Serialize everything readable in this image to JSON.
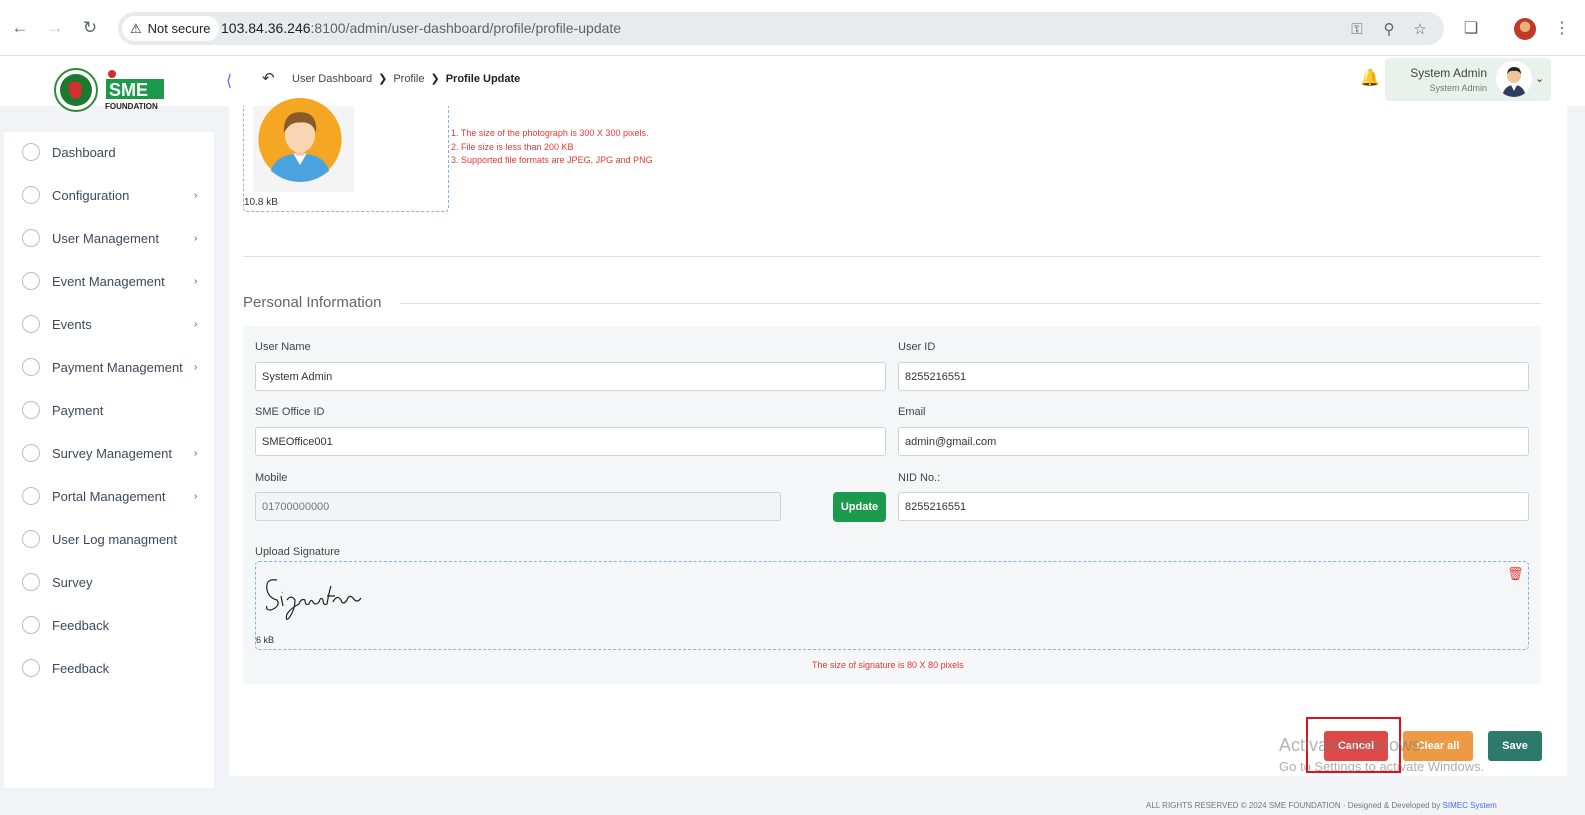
{
  "browser": {
    "security_label": "Not secure",
    "url_host": "103.84.36.246",
    "url_rest": ":8100/admin/user-dashboard/profile/profile-update"
  },
  "header": {
    "logo_text": "SME",
    "logo_subtext": "FOUNDATION",
    "breadcrumb": [
      "User Dashboard",
      "Profile",
      "Profile Update"
    ],
    "user_name": "System Admin",
    "user_role": "System Admin"
  },
  "sidebar": {
    "items": [
      {
        "label": "Dashboard",
        "icon": "dashboard-icon",
        "has_children": false
      },
      {
        "label": "Configuration",
        "icon": "configuration-icon",
        "has_children": true
      },
      {
        "label": "User Management",
        "icon": "user-management-icon",
        "has_children": true
      },
      {
        "label": "Event Management",
        "icon": "lock-icon",
        "has_children": true
      },
      {
        "label": "Events",
        "icon": "lock-icon",
        "has_children": true
      },
      {
        "label": "Payment Management",
        "icon": "payment-icon",
        "has_children": true
      },
      {
        "label": "Payment",
        "icon": "payment-icon",
        "has_children": false
      },
      {
        "label": "Survey Management",
        "icon": "pie-chart-icon",
        "has_children": true
      },
      {
        "label": "Portal Management",
        "icon": "lock-icon",
        "has_children": true
      },
      {
        "label": "User Log managment",
        "icon": "payment-icon",
        "has_children": false
      },
      {
        "label": "Survey",
        "icon": "pie-chart-icon",
        "has_children": false
      },
      {
        "label": "Feedback",
        "icon": "feedback-icon",
        "has_children": false
      },
      {
        "label": "Feedback",
        "icon": "feedback-icon",
        "has_children": false
      }
    ]
  },
  "photo": {
    "size": "10.8 kB",
    "rules": [
      "1. The size of the photograph is 300 X 300 pixels.",
      "2. File size is less than 200 KB",
      "3. Supported file formats are JPEG, JPG and PNG"
    ]
  },
  "personal": {
    "title": "Personal Information",
    "user_name_label": "User Name",
    "user_name_value": "System Admin",
    "user_id_label": "User ID",
    "user_id_value": "8255216551",
    "office_label": "SME Office ID",
    "office_value": "SMEOffice001",
    "email_label": "Email",
    "email_value": "admin@gmail.com",
    "mobile_label": "Mobile",
    "mobile_placeholder": "01700000000",
    "update_label": "Update",
    "nid_label": "NID No.:",
    "nid_value": "8255216551",
    "signature_label": "Upload Signature",
    "signature_size": "6 kB",
    "signature_rule": "The size of signature is 80 X 80 pixels"
  },
  "actions": {
    "cancel": "Cancel",
    "clear": "Clear all",
    "save": "Save"
  },
  "watermark": {
    "line1": "Activate Windows",
    "line2": "Go to Settings to activate Windows."
  },
  "footer": {
    "text": "ALL RIGHTS RESERVED © 2024 SME FOUNDATION · Designed & Developed by",
    "credit": "SIMEC System"
  }
}
